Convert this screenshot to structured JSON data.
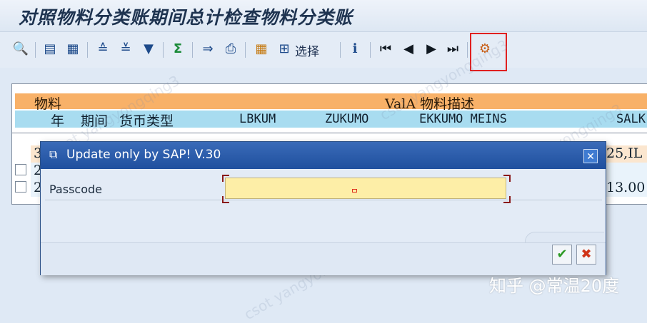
{
  "window": {
    "title": "对照物料分类账期间总计检查物料分类账"
  },
  "toolbar": {
    "select_label": "选择",
    "buttons": [
      {
        "name": "detail-icon",
        "glyph": "🔍"
      },
      {
        "name": "first-column-icon",
        "glyph": "▤"
      },
      {
        "name": "layout-icon",
        "glyph": "▦"
      },
      {
        "name": "sort-ascending-icon",
        "glyph": "≙"
      },
      {
        "name": "sort-descending-icon",
        "glyph": "≚"
      },
      {
        "name": "filter-icon",
        "glyph": "▼"
      },
      {
        "name": "sum-icon",
        "glyph": "Σ"
      },
      {
        "name": "export-icon",
        "glyph": "⇒"
      },
      {
        "name": "print-icon",
        "glyph": "⎙"
      },
      {
        "name": "grid-icon",
        "glyph": "▦"
      },
      {
        "name": "select-icon",
        "glyph": "⊞"
      },
      {
        "name": "info-icon",
        "glyph": "ℹ"
      },
      {
        "name": "first-page-icon",
        "glyph": "⏮"
      },
      {
        "name": "previous-page-icon",
        "glyph": "◀"
      },
      {
        "name": "next-page-icon",
        "glyph": "▶"
      },
      {
        "name": "last-page-icon",
        "glyph": "⏭"
      },
      {
        "name": "settings-tool-icon",
        "glyph": "⚙"
      }
    ]
  },
  "list": {
    "header_row1": {
      "col1": "物料",
      "col2": "ValA 物料描述"
    },
    "header_row2": {
      "year": "年",
      "period": "期间",
      "currency_type": "货币类型",
      "lbkum": "LBKUM",
      "zukumo": "ZUKUMO",
      "ekkumo_meins": "EKKUMO MEINS",
      "salk": "SALK"
    },
    "rows": [
      {
        "left": "3",
        "right": "25,IL"
      },
      {
        "left": "2",
        "right": ""
      },
      {
        "left": "2",
        "right": "13.00"
      }
    ]
  },
  "dialog": {
    "title": "Update only by SAP! V.30",
    "passcode_label": "Passcode",
    "passcode_value": ""
  },
  "watermark": {
    "text": "csot yangyongqing3",
    "brand": "知乎 @常温20度"
  },
  "colors": {
    "header_orange": "#f8b168",
    "header_cyan": "#a8dcf0",
    "dialog_title": "#1f4f9e",
    "input_bg": "#fdeea7",
    "highlight": "#e02020"
  }
}
